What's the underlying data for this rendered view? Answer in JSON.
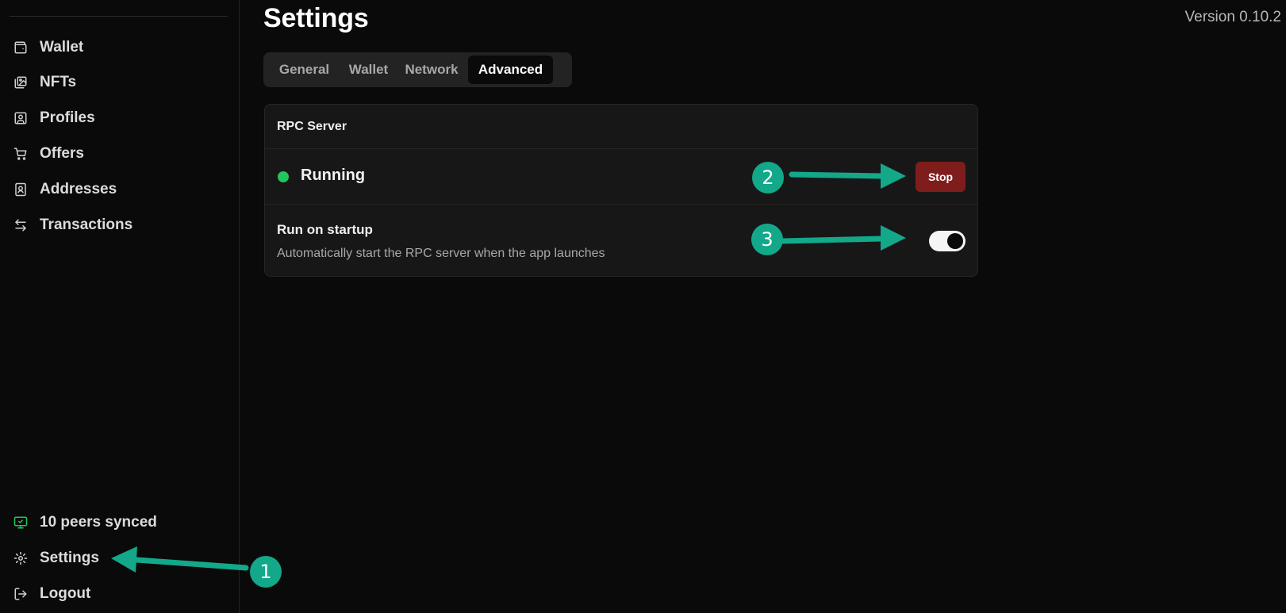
{
  "sidebar": {
    "nav": [
      {
        "label": "Wallet",
        "icon": "wallet-icon"
      },
      {
        "label": "NFTs",
        "icon": "images-icon"
      },
      {
        "label": "Profiles",
        "icon": "user-square-icon"
      },
      {
        "label": "Offers",
        "icon": "cart-icon"
      },
      {
        "label": "Addresses",
        "icon": "contact-book-icon"
      },
      {
        "label": "Transactions",
        "icon": "arrows-left-right-icon"
      }
    ],
    "bottom": [
      {
        "label": "10 peers synced",
        "icon": "monitor-check-icon",
        "icon_color": "#22c55e"
      },
      {
        "label": "Settings",
        "icon": "gear-icon"
      },
      {
        "label": "Logout",
        "icon": "logout-icon"
      }
    ]
  },
  "header": {
    "title": "Settings",
    "version": "Version 0.10.2"
  },
  "tabs": {
    "items": [
      "General",
      "Wallet",
      "Network",
      "Advanced"
    ],
    "active": "Advanced"
  },
  "rpc_card": {
    "title": "RPC Server",
    "status": "Running",
    "status_color": "#22c55e",
    "stop_label": "Stop",
    "startup_label": "Run on startup",
    "startup_desc": "Automatically start the RPC server when the app launches",
    "startup_enabled": true
  },
  "annotations": {
    "badge_1": "1",
    "badge_2": "2",
    "badge_3": "3",
    "color": "#13a88a"
  }
}
